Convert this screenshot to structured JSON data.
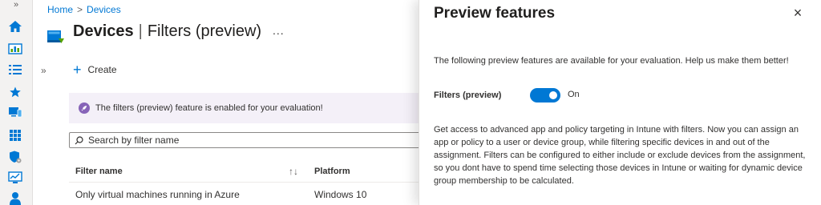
{
  "rail": {
    "toggle_glyph": "»",
    "icons": [
      "home-icon",
      "dashboard-icon",
      "all-services-icon",
      "favorites-star-icon",
      "devices-icon",
      "apps-grid-icon",
      "endpoint-security-icon",
      "reports-monitor-icon",
      "users-icon"
    ]
  },
  "breadcrumb": {
    "home": "Home",
    "separator": ">",
    "current": "Devices"
  },
  "header": {
    "title": "Devices",
    "separator": "|",
    "subtitle": "Filters (preview)",
    "more": "..."
  },
  "content": {
    "collapse_glyph": "»",
    "create_label": "Create",
    "banner_text": "The filters (preview) feature is enabled for your evaluation!",
    "search_placeholder": "Search by filter name"
  },
  "table": {
    "columns": [
      "Filter name",
      "Platform"
    ],
    "sort_glyph": "↑↓",
    "rows": [
      {
        "name": "Only virtual machines running in Azure",
        "platform": "Windows 10"
      }
    ]
  },
  "panel": {
    "title": "Preview features",
    "close_glyph": "×",
    "intro": "The following preview features are available for your evaluation. Help us make them better!",
    "feature_label": "Filters (preview)",
    "feature_state": "On",
    "feature_on": true,
    "description": "Get access to advanced app and policy targeting in Intune with filters. Now you can assign an app or policy to a user or device group, while filtering specific devices in and out of the assignment. Filters can be configured to either include or exclude devices from the assignment, so you dont have to spend time selecting those devices in Intune or waiting for dynamic device group membership to be calculated."
  },
  "colors": {
    "accent": "#0078d4",
    "banner_bg": "#f4f0f8",
    "banner_icon": "#8764b8"
  }
}
